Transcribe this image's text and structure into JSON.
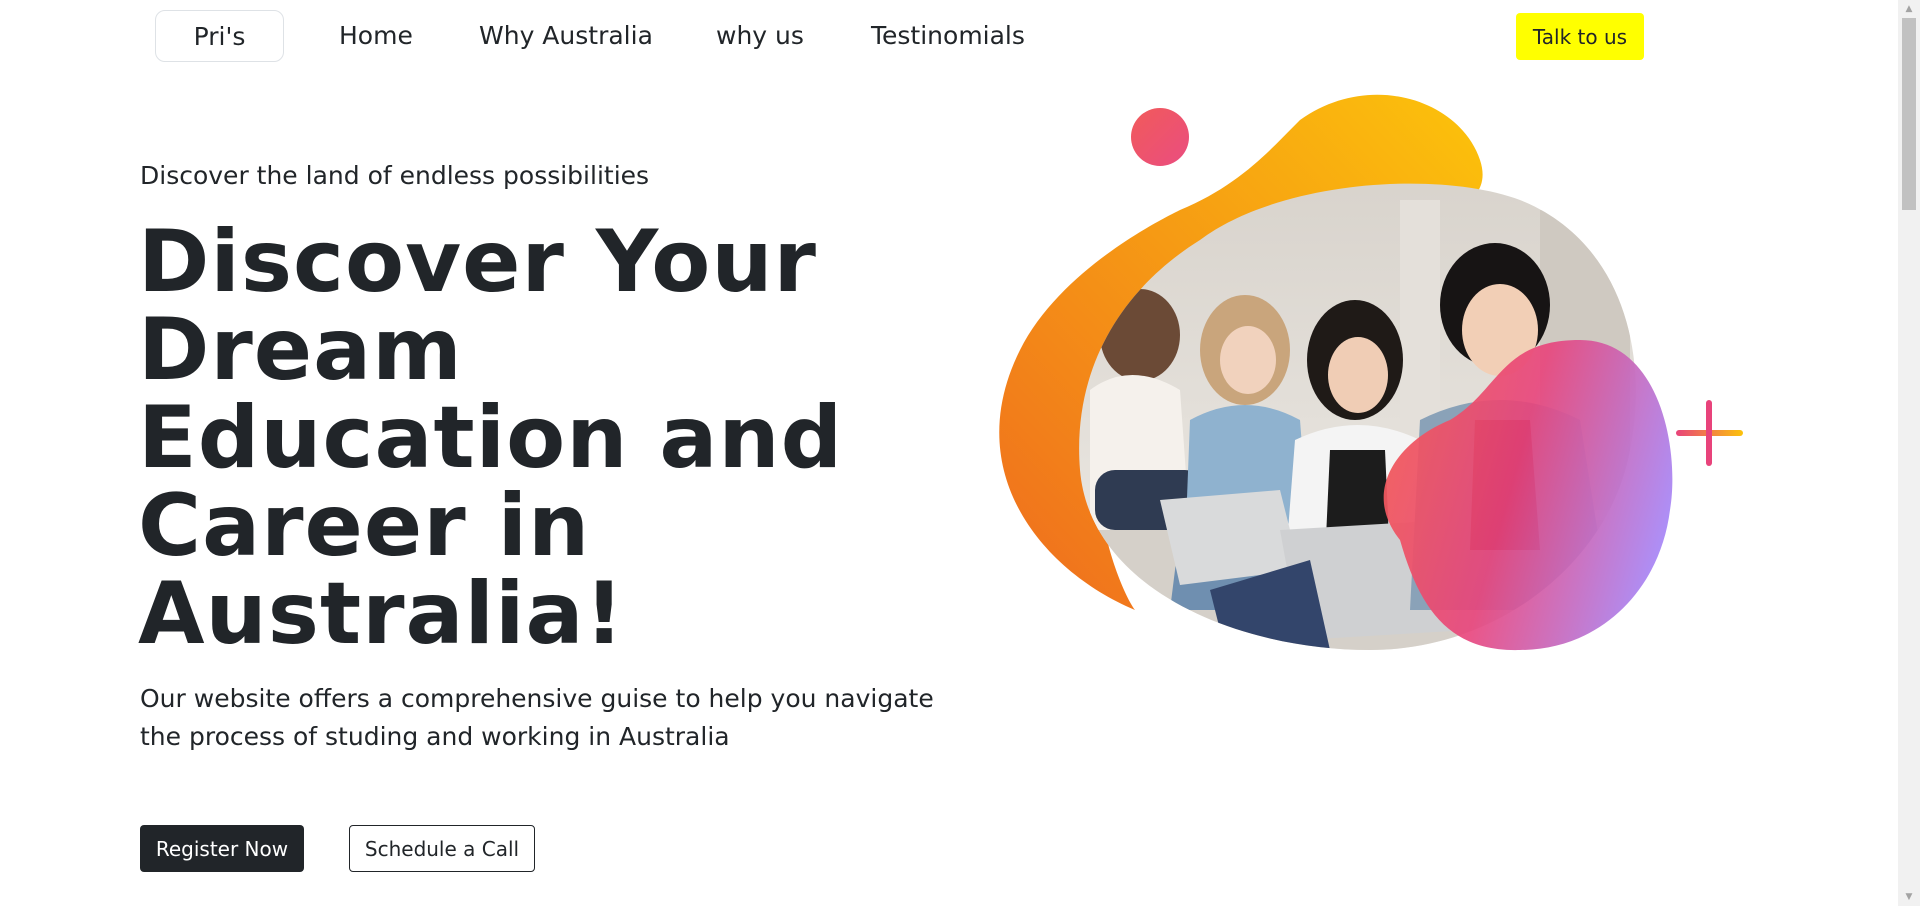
{
  "nav": {
    "brand": "Pri's",
    "links": [
      "Home",
      "Why Australia",
      "why us",
      "Testinomials"
    ],
    "cta": "Talk to us"
  },
  "hero": {
    "eyebrow": "Discover the land of endless possibilities",
    "headline_lines": [
      "Discover Your",
      "Dream",
      "Education and",
      "Career in",
      "Australia!"
    ],
    "lead_lines": [
      "Our website offers a comprehensive guise to help you navigate",
      "the process of studing and working in Australia"
    ],
    "primary_button": "Register Now",
    "secondary_button": "Schedule a Call"
  },
  "colors": {
    "cta_yellow": "#ffff00",
    "dark": "#212529",
    "blob_orange": "#f7941d",
    "blob_pink": "#e8437b",
    "blob_purple": "#a78bfa"
  }
}
